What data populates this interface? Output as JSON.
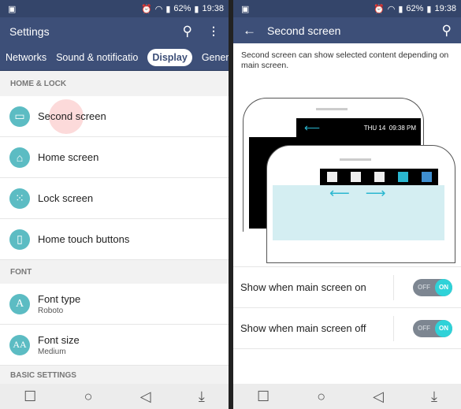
{
  "status": {
    "battery": "62%",
    "time": "19:38"
  },
  "left": {
    "title": "Settings",
    "tabs": [
      "Networks",
      "Sound & notificatio",
      "Display",
      "General"
    ],
    "active_tab": "Display",
    "sections": [
      {
        "header": "HOME & LOCK",
        "items": [
          {
            "label": "Second screen",
            "icon": "second-screen-icon"
          },
          {
            "label": "Home screen",
            "icon": "home-icon"
          },
          {
            "label": "Lock screen",
            "icon": "lock-pattern-icon"
          },
          {
            "label": "Home touch buttons",
            "icon": "phone-icon"
          }
        ]
      },
      {
        "header": "FONT",
        "items": [
          {
            "label": "Font type",
            "sub": "Roboto",
            "icon": "font-type-icon"
          },
          {
            "label": "Font size",
            "sub": "Medium",
            "icon": "font-size-icon"
          }
        ]
      },
      {
        "header": "BASIC SETTINGS"
      }
    ]
  },
  "right": {
    "title": "Second screen",
    "description": "Second screen can show selected content depending on main screen.",
    "illustration": {
      "date": "THU 14",
      "time": "09:38 PM"
    },
    "rows": [
      {
        "label": "Show when main screen on",
        "off": "OFF",
        "on": "ON",
        "value": true
      },
      {
        "label": "Show when main screen off",
        "off": "OFF",
        "on": "ON",
        "value": true
      }
    ]
  },
  "colors": {
    "header": "#3d4f78",
    "accent": "#5cbcc3",
    "toggle_on": "#2fd2d8"
  }
}
